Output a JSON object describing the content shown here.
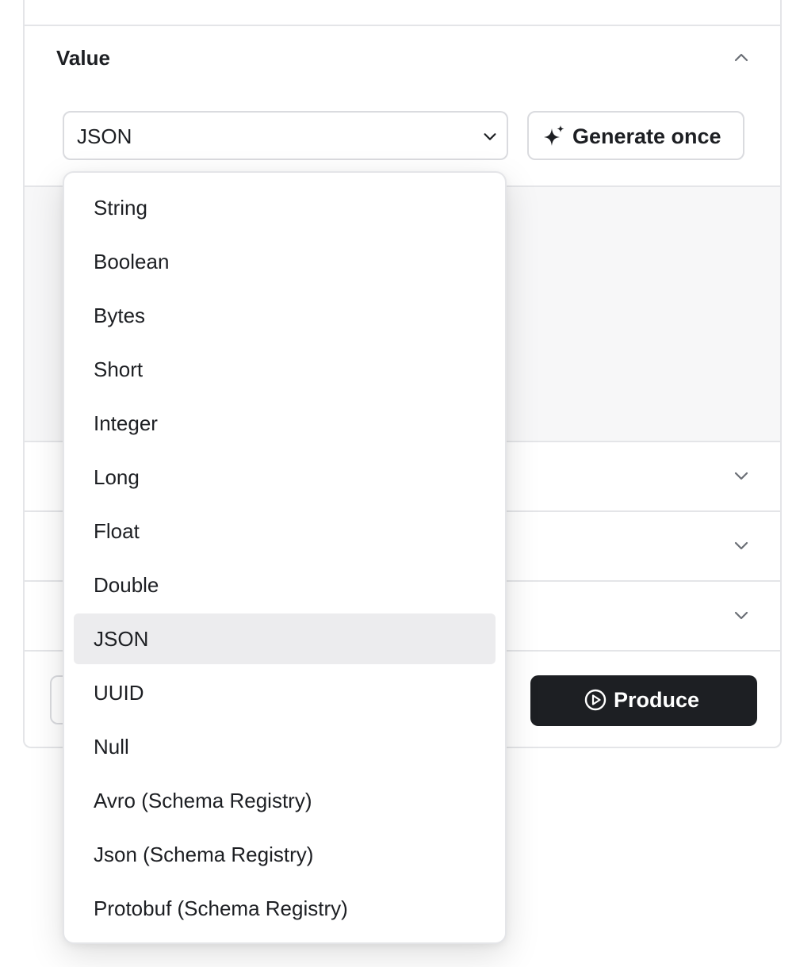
{
  "value_section": {
    "title": "Value",
    "format_select": {
      "selected": "JSON",
      "options": [
        "String",
        "Boolean",
        "Bytes",
        "Short",
        "Integer",
        "Long",
        "Float",
        "Double",
        "JSON",
        "UUID",
        "Null",
        "Avro (Schema Registry)",
        "Json (Schema Registry)",
        "Protobuf (Schema Registry)"
      ]
    },
    "generate_button": {
      "label": "Generate once",
      "icon": "sparkle-icon"
    }
  },
  "collapsed_sections": {
    "chevrons": [
      "chevron-down-icon",
      "chevron-down-icon",
      "chevron-down-icon"
    ]
  },
  "footer": {
    "produce_button": {
      "label": "Produce",
      "icon": "play-circle-icon"
    }
  },
  "colors": {
    "primary_button": "#1d1f23",
    "border": "#e4e5e8",
    "selected_option": "#ececee",
    "text": "#1d1f23"
  }
}
